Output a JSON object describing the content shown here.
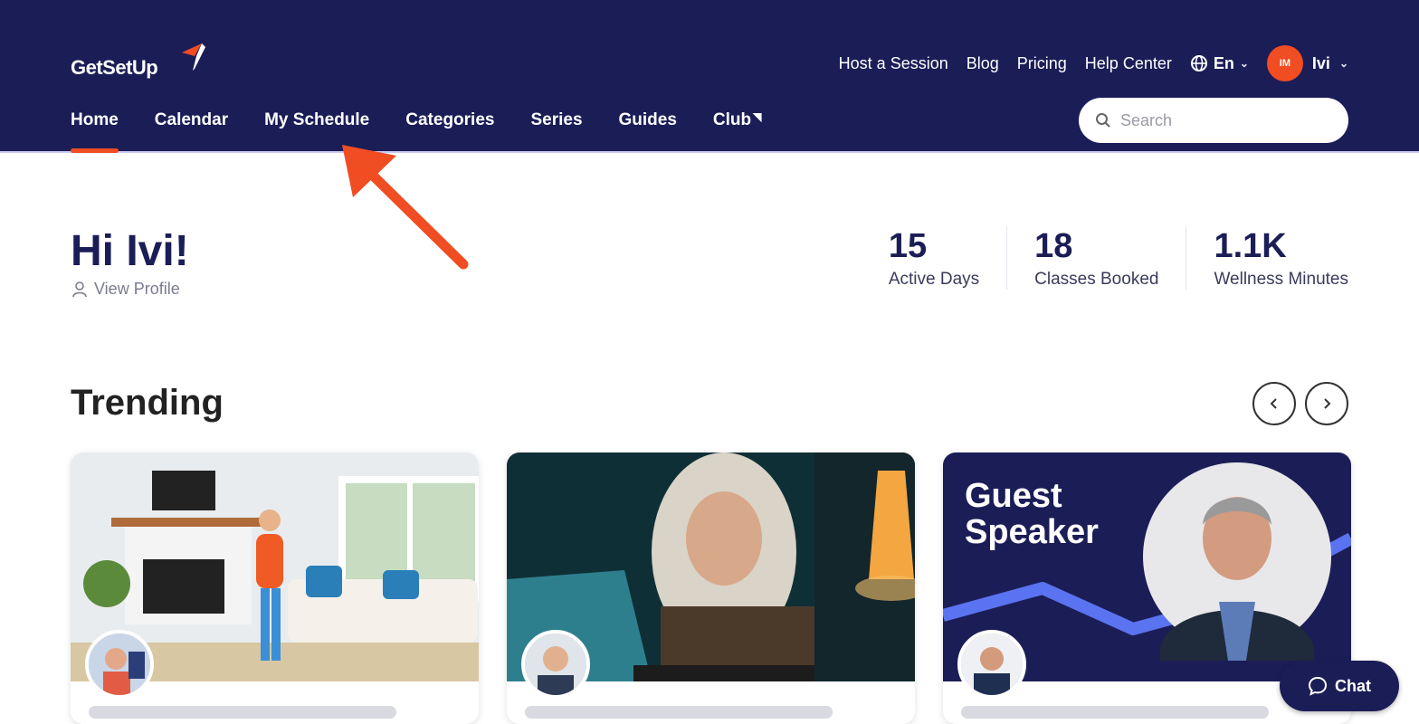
{
  "brand": {
    "name": "GetSetUp",
    "accent": "#f04d23",
    "navy": "#1b1d57"
  },
  "top_links": [
    "Host a Session",
    "Blog",
    "Pricing",
    "Help Center"
  ],
  "language": {
    "icon": "globe-icon",
    "label": "En"
  },
  "user": {
    "initials": "IM",
    "name": "Ivi"
  },
  "nav_tabs": [
    "Home",
    "Calendar",
    "My Schedule",
    "Categories",
    "Series",
    "Guides",
    "Club"
  ],
  "active_tab": "Home",
  "search": {
    "placeholder": "Search"
  },
  "greeting": {
    "title": "Hi Ivi!",
    "view_profile": "View Profile"
  },
  "stats": [
    {
      "value": "15",
      "label": "Active Days"
    },
    {
      "value": "18",
      "label": "Classes Booked"
    },
    {
      "value": "1.1K",
      "label": "Wellness Minutes"
    }
  ],
  "trending": {
    "title": "Trending",
    "cards": [
      {
        "image": "woman-exercising-living-room"
      },
      {
        "image": "woman-using-laptop-at-night"
      },
      {
        "image": "guest-speaker-portrait",
        "overlay_text": "Guest Speaker"
      }
    ]
  },
  "chat": {
    "label": "Chat"
  }
}
